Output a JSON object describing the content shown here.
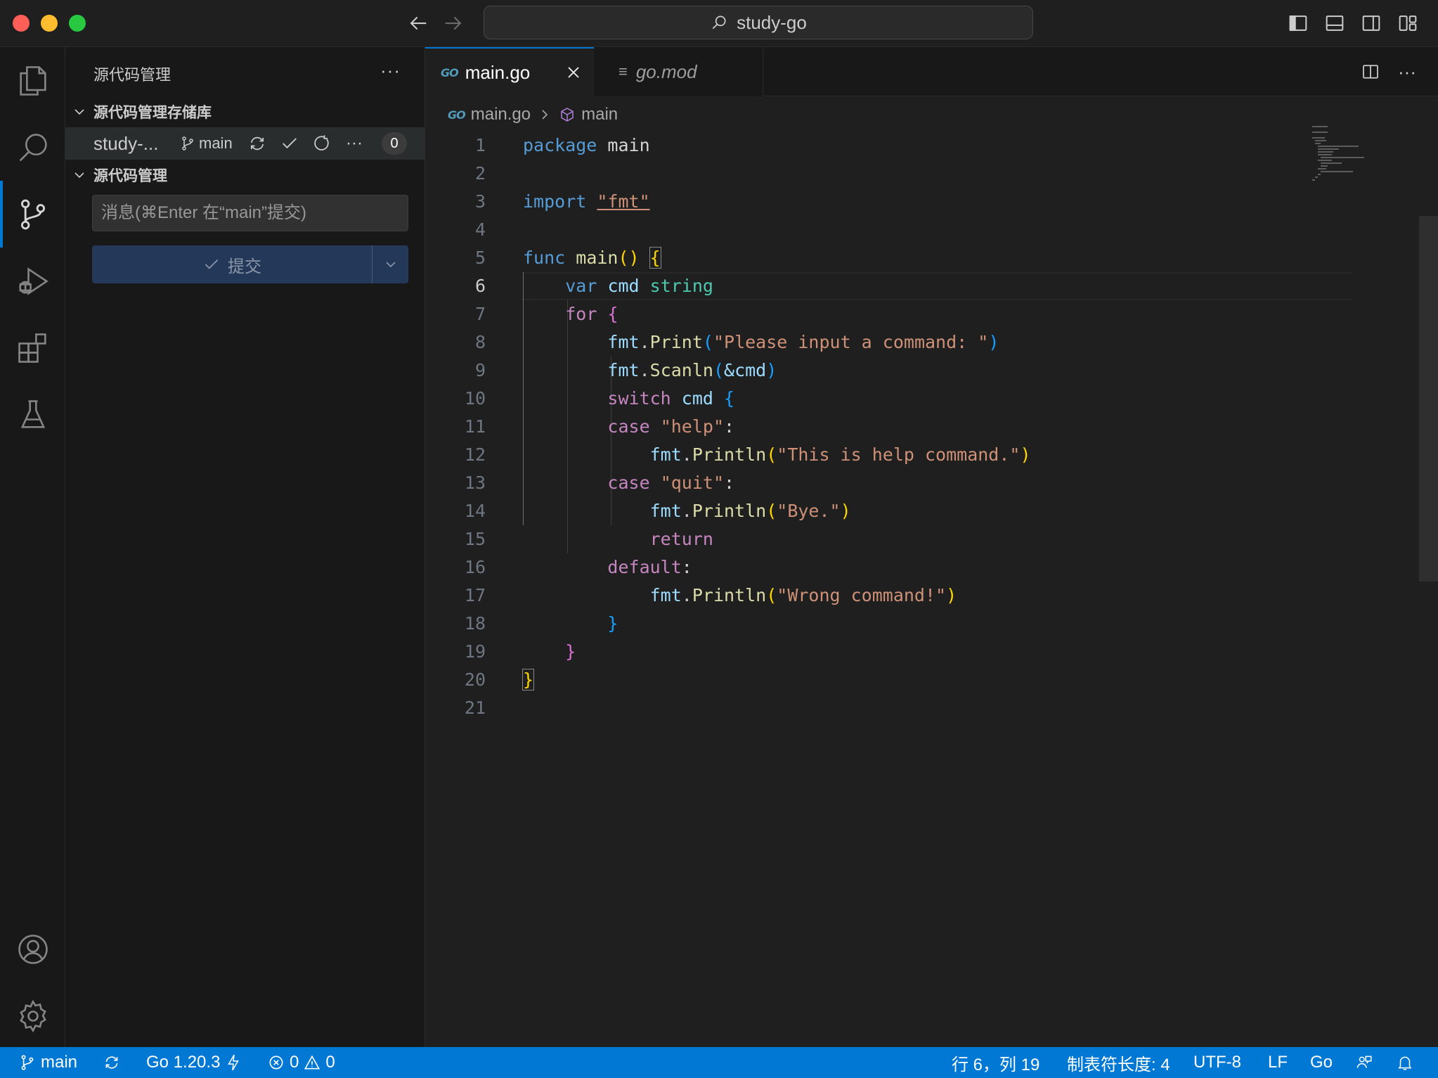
{
  "window": {
    "title": "study-go"
  },
  "sidebar": {
    "title": "源代码管理",
    "more": "···",
    "repos_section": "源代码管理存储库",
    "repo": {
      "name": "study-...",
      "branch": "main",
      "changes": "0"
    },
    "scm_section": "源代码管理",
    "message_placeholder": "消息(⌘Enter 在“main”提交)",
    "commit_label": "提交"
  },
  "editor": {
    "tabs": [
      {
        "icon": "GO",
        "label": "main.go"
      },
      {
        "icon": "≡",
        "label": "go.mod"
      }
    ],
    "more": "···",
    "breadcrumb": {
      "file": "main.go",
      "symbol": "main"
    },
    "current_line": 6,
    "line_numbers": [
      "1",
      "2",
      "3",
      "4",
      "5",
      "6",
      "7",
      "8",
      "9",
      "10",
      "11",
      "12",
      "13",
      "14",
      "15",
      "16",
      "17",
      "18",
      "19",
      "20",
      "21"
    ]
  },
  "code": {
    "l1": {
      "k": "package",
      "n": "main"
    },
    "l3": {
      "k": "import",
      "s": "\"fmt\""
    },
    "l5": {
      "k": "func",
      "f": "main",
      "p": "()",
      "b": "{"
    },
    "l6": {
      "k": "var",
      "v": "cmd",
      "t": "string"
    },
    "l7": {
      "k": "for",
      "b": "{"
    },
    "l8": {
      "pkg": "fmt",
      "f": "Print",
      "s": "\"Please input a command: \""
    },
    "l9": {
      "pkg": "fmt",
      "f": "Scanln",
      "a": "&cmd"
    },
    "l10": {
      "k": "switch",
      "v": "cmd",
      "b": "{"
    },
    "l11": {
      "k": "case",
      "s": "\"help\""
    },
    "l12": {
      "pkg": "fmt",
      "f": "Println",
      "s": "\"This is help command.\""
    },
    "l13": {
      "k": "case",
      "s": "\"quit\""
    },
    "l14": {
      "pkg": "fmt",
      "f": "Println",
      "s": "\"Bye.\""
    },
    "l15": {
      "k": "return"
    },
    "l16": {
      "k": "default"
    },
    "l17": {
      "pkg": "fmt",
      "f": "Println",
      "s": "\"Wrong command!\""
    },
    "l18": {
      "b": "}"
    },
    "l19": {
      "b": "}"
    },
    "l20": {
      "b": "}"
    }
  },
  "statusbar": {
    "branch": "main",
    "go_version": "Go 1.20.3",
    "errors": "0",
    "warnings": "0",
    "position": "行 6，列 19",
    "tab_size": "制表符长度: 4",
    "encoding": "UTF-8",
    "eol": "LF",
    "language": "Go"
  },
  "colors": {
    "accent": "#0078d4",
    "statusbar": "#0078d4",
    "commit_button": "#24385a"
  }
}
